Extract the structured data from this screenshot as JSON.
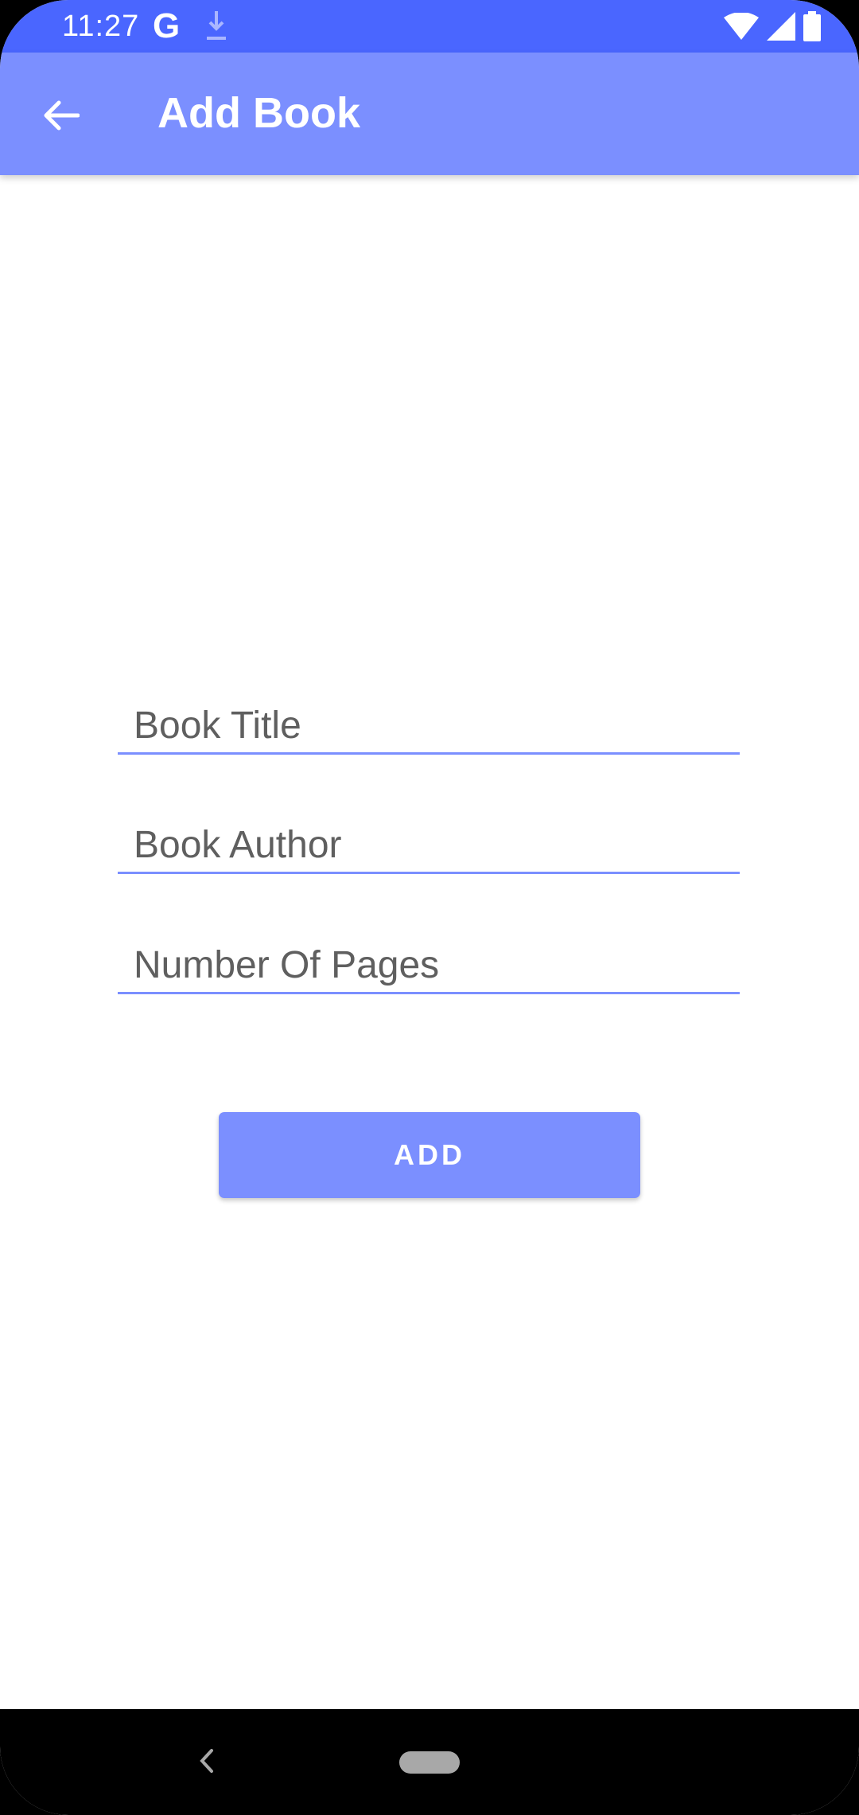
{
  "status_bar": {
    "time": "11:27",
    "google_glyph": "G",
    "icons": [
      "download-icon",
      "wifi-icon",
      "signal-icon",
      "battery-icon"
    ]
  },
  "app_bar": {
    "title": "Add Book",
    "back_icon": "arrow-back-icon"
  },
  "form": {
    "title_placeholder": "Book Title",
    "author_placeholder": "Book Author",
    "pages_placeholder": "Number Of Pages",
    "add_label": "ADD"
  },
  "colors": {
    "status_bar": "#4a66ff",
    "primary": "#7b8fff",
    "background": "#ffffff"
  },
  "nav_bar": {
    "icons": [
      "nav-back-icon",
      "nav-home-pill"
    ]
  }
}
